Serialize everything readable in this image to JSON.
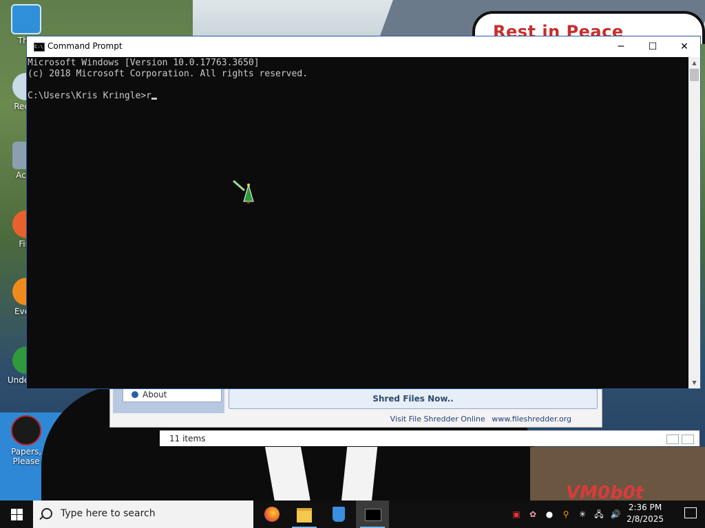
{
  "desktop": {
    "sign_text": "Rest in Peace",
    "watermark": "VM0b0t",
    "icons": [
      {
        "label": "This",
        "glyph": "this-pc-icon"
      },
      {
        "label": "Recyc",
        "glyph": "recycle-bin-icon"
      },
      {
        "label": "Activ",
        "glyph": "app-icon"
      },
      {
        "label": "Fire",
        "glyph": "firefox-icon"
      },
      {
        "label": "Every",
        "glyph": "everything-icon"
      },
      {
        "label": "Undelete",
        "glyph": "undelete-icon"
      },
      {
        "label": "Papers, Please",
        "glyph": "papers-please-icon"
      }
    ]
  },
  "file_shredder": {
    "about_label": "About",
    "shred_button": "Shred Files Now..",
    "visit_label": "Visit File Shredder Online",
    "site_link": "www.fileshredder.org"
  },
  "explorer": {
    "item_count": "11 items"
  },
  "cmd": {
    "title": "Command Prompt",
    "icon_text": "C:\\",
    "minimize": "─",
    "maximize": "☐",
    "close": "✕",
    "lines": [
      "Microsoft Windows [Version 10.0.17763.3650]",
      "(c) 2018 Microsoft Corporation. All rights reserved.",
      "",
      "C:\\Users\\Kris Kringle>r"
    ]
  },
  "taskbar": {
    "search_placeholder": "Type here to search",
    "apps": [
      "firefox-icon",
      "file-explorer-icon",
      "recycle-bin-icon",
      "command-prompt-icon"
    ],
    "time": "2:36 PM",
    "date": "2/8/2025"
  },
  "colors": {
    "console_bg": "#0c0c0c",
    "console_text": "#cccccc",
    "taskbar_bg": "#101010",
    "accent": "#76b9ed",
    "sign_red": "#c62e2e"
  }
}
